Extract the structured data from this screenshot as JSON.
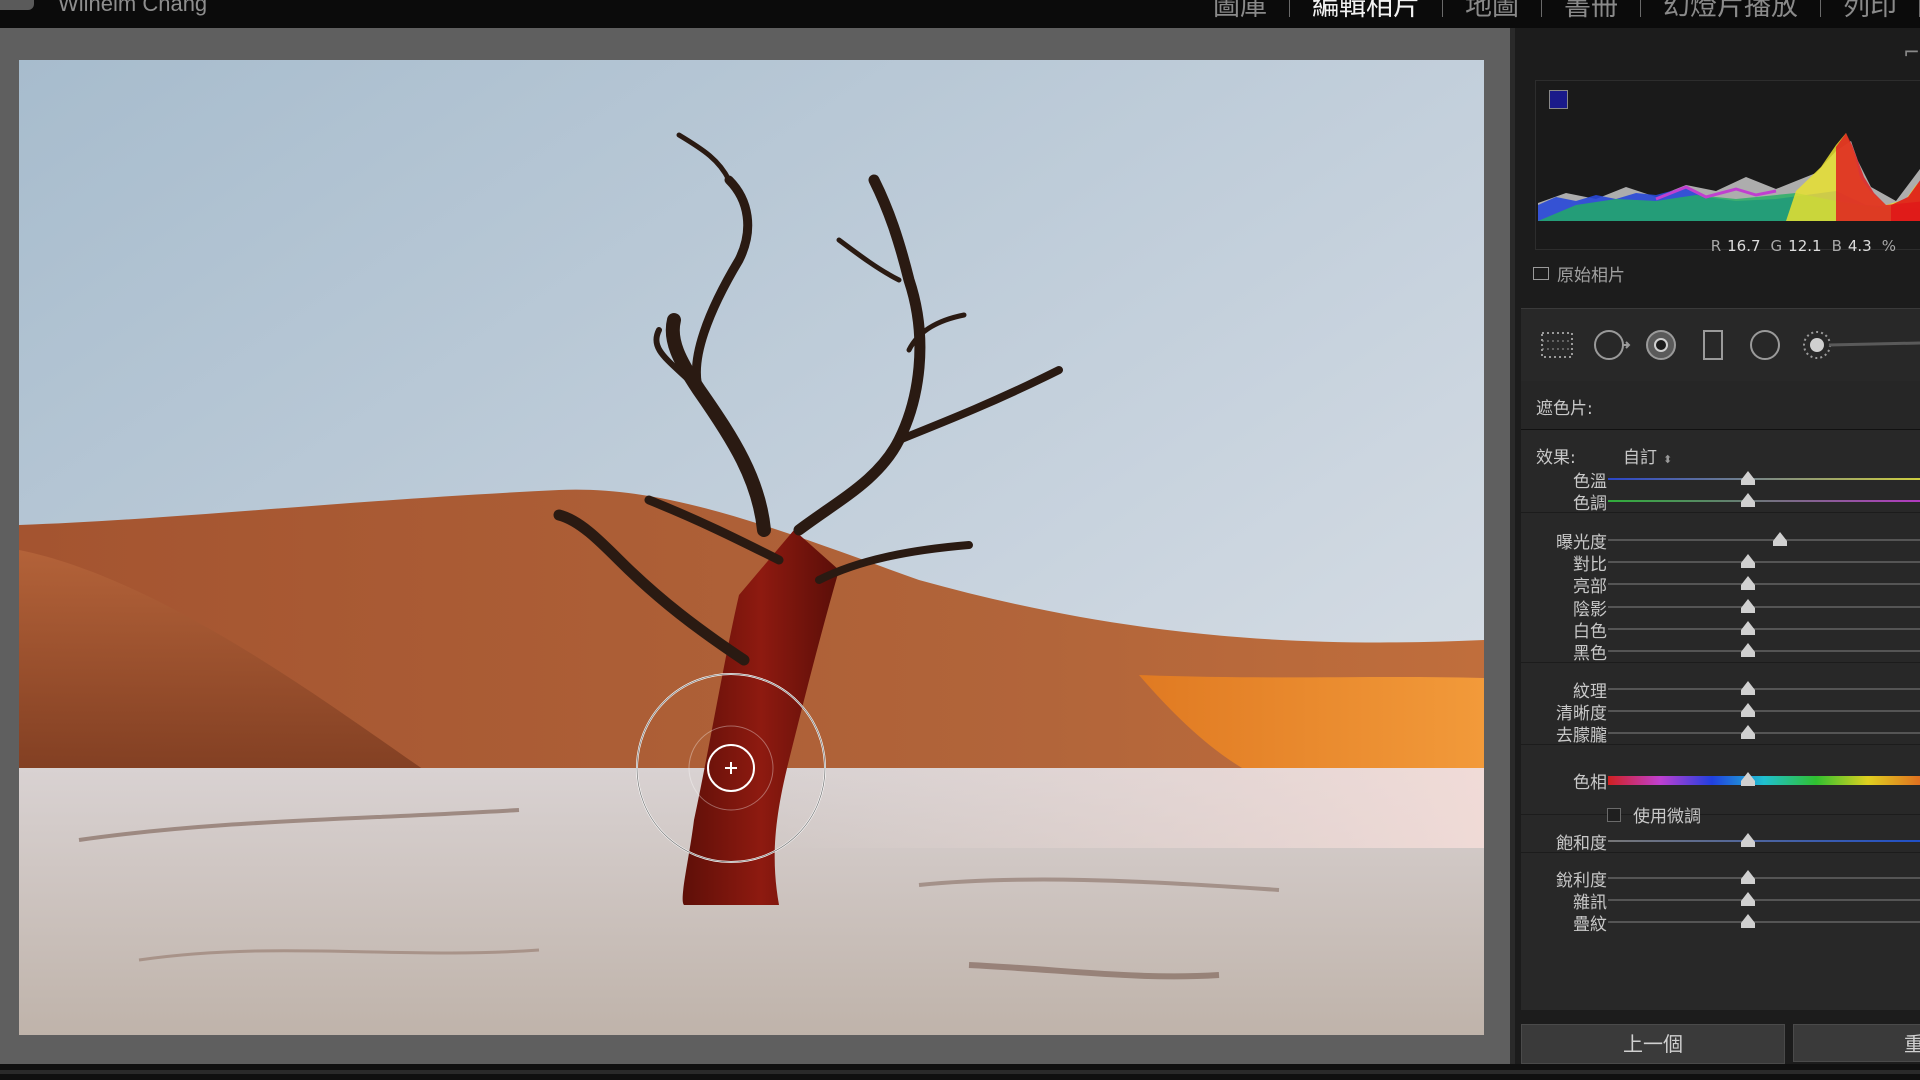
{
  "header": {
    "user_name": "Wilhelm Chang",
    "modules": [
      {
        "label": "圖庫",
        "active": false
      },
      {
        "label": "編輯相片",
        "active": true
      },
      {
        "label": "地圖",
        "active": false
      },
      {
        "label": "書冊",
        "active": false
      },
      {
        "label": "幻燈片播放",
        "active": false
      },
      {
        "label": "列印",
        "active": false
      }
    ]
  },
  "histogram": {
    "r_label": "R",
    "r_value": "16.7",
    "g_label": "G",
    "g_value": "12.1",
    "b_label": "B",
    "b_value": "4.3",
    "unit": "%"
  },
  "original_photo_label": "原始相片",
  "mask_label": "遮色片:",
  "effect": {
    "label": "效果:",
    "value": "自訂"
  },
  "sliders": [
    {
      "label": "色溫",
      "value": 0.45,
      "track": "temp"
    },
    {
      "label": "色調",
      "value": 0.45,
      "track": "tint"
    },
    {
      "label": "曝光度",
      "value": 0.55,
      "track": "plain"
    },
    {
      "label": "對比",
      "value": 0.45,
      "track": "plain"
    },
    {
      "label": "亮部",
      "value": 0.45,
      "track": "plain"
    },
    {
      "label": "陰影",
      "value": 0.45,
      "track": "plain"
    },
    {
      "label": "白色",
      "value": 0.45,
      "track": "plain"
    },
    {
      "label": "黑色",
      "value": 0.45,
      "track": "plain"
    },
    {
      "label": "紋理",
      "value": 0.45,
      "track": "plain"
    },
    {
      "label": "清晰度",
      "value": 0.45,
      "track": "plain"
    },
    {
      "label": "去朦朧",
      "value": 0.45,
      "track": "plain"
    },
    {
      "label": "色相",
      "value": 0.45,
      "track": "hue"
    },
    {
      "label": "飽和度",
      "value": 0.45,
      "track": "sat"
    },
    {
      "label": "銳利度",
      "value": 0.45,
      "track": "plain"
    },
    {
      "label": "雜訊",
      "value": 0.45,
      "track": "plain"
    },
    {
      "label": "疊紋",
      "value": 0.45,
      "track": "plain"
    }
  ],
  "fine_tune_label": "使用微調",
  "buttons": {
    "prev": "上一個",
    "next": "重"
  },
  "icons": {
    "brush_tool": "brush-crosshair-icon",
    "panel_corner": "panel-corner-icon"
  }
}
